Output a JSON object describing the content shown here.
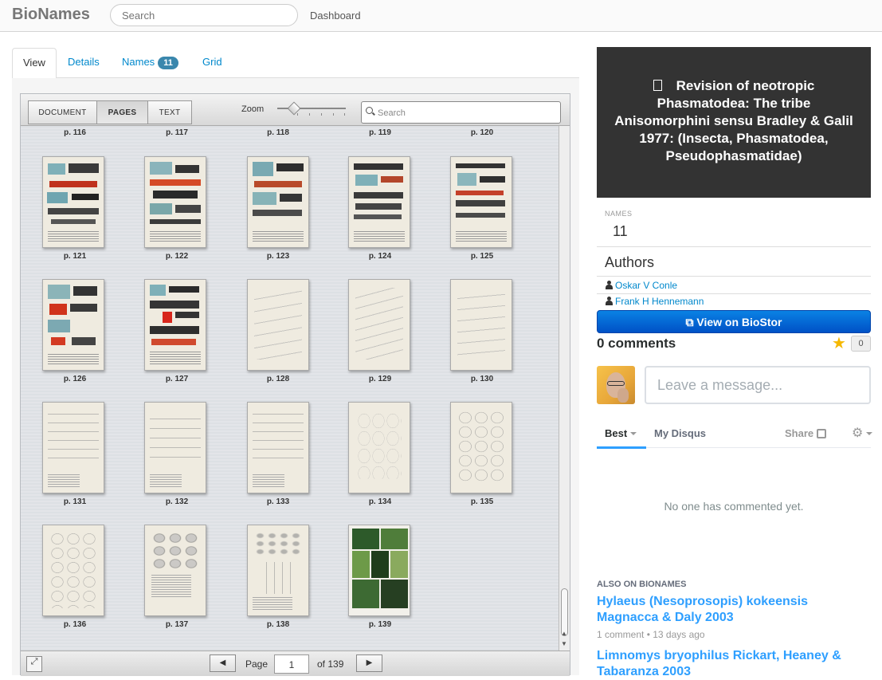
{
  "navbar": {
    "brand": "BioNames",
    "search_placeholder": "Search",
    "dashboard": "Dashboard"
  },
  "tabs": {
    "view": "View",
    "details": "Details",
    "names": "Names",
    "names_count": "11",
    "grid": "Grid"
  },
  "viewer": {
    "modes": {
      "document": "DOCUMENT",
      "pages": "PAGES",
      "text": "TEXT"
    },
    "zoom_label": "Zoom",
    "search_placeholder": "Search",
    "top_labels": [
      "p. 116",
      "p. 117",
      "p. 118",
      "p. 119",
      "p. 120"
    ],
    "rows": [
      [
        "p. 121",
        "p. 122",
        "p. 123",
        "p. 124",
        "p. 125"
      ],
      [
        "p. 126",
        "p. 127",
        "p. 128",
        "p. 129",
        "p. 130"
      ],
      [
        "p. 131",
        "p. 132",
        "p. 133",
        "p. 134",
        "p. 135"
      ],
      [
        "p. 136",
        "p. 137",
        "p. 138",
        "p. 139"
      ]
    ],
    "pagination": {
      "page_word": "Page",
      "current": "1",
      "of_total": "of 139",
      "prev_icon": "◀",
      "next_icon": "▶"
    }
  },
  "article": {
    "title": "Revision of neotropic Phasmatodea: The tribe Anisomorphini sensu Bradley & Galil 1977: (Insecta, Phasmatodea, Pseudophasmatidae)",
    "names_label": "NAMES",
    "names_value": "11",
    "authors_heading": "Authors",
    "authors": [
      "Oskar V Conle",
      "Frank H Hennemann"
    ],
    "biostor_button": "View on BioStor"
  },
  "disqus": {
    "comments_count": "0 comments",
    "star_count": "0",
    "message_placeholder": "Leave a message...",
    "tabs": {
      "best": "Best",
      "my_disqus": "My Disqus",
      "share": "Share"
    },
    "empty_text": "No one has commented yet.",
    "also_on": "ALSO ON BIONAMES",
    "also_items": [
      {
        "title": "Hylaeus (Nesoprosopis) kokeensis Magnacca & Daly 2003",
        "meta": "1 comment • 13 days ago"
      },
      {
        "title": "Limnomys bryophilus Rickart, Heaney & Tabaranza 2003"
      }
    ]
  },
  "colors": {
    "link": "#0088cc",
    "biostor": "#0a6fdc",
    "disqus_accent": "#2e9fff",
    "title_bg": "#333333",
    "badge": "#3a87ad"
  }
}
